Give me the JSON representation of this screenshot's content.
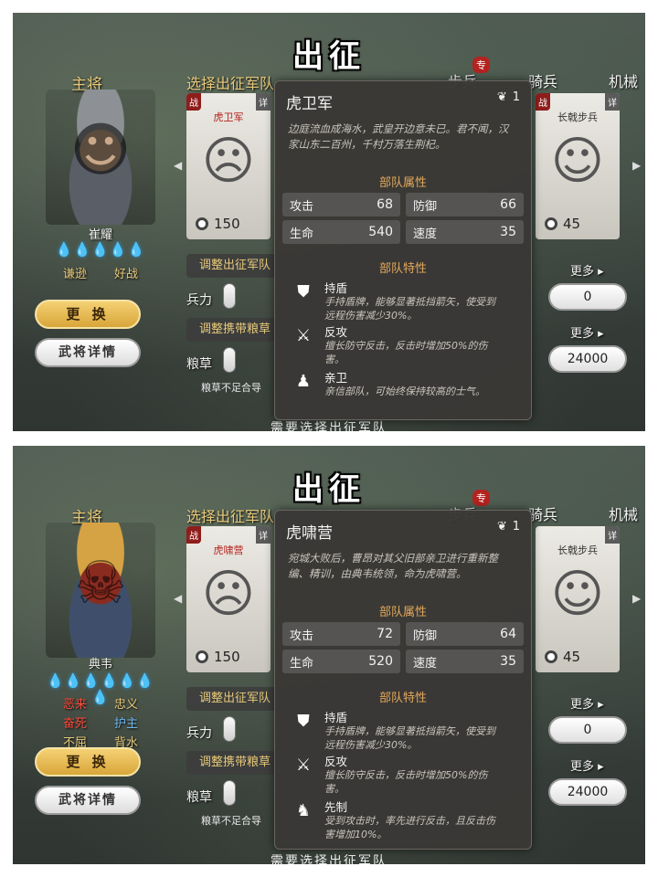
{
  "screens": [
    {
      "title": "出征",
      "commander_label": "主将",
      "general": {
        "name": "崔耀",
        "stars": "💧💧💧💧💧",
        "traits": [
          {
            "text": "谦逊",
            "color": "#e8c97a"
          },
          {
            "text": "好战",
            "color": "#e8c97a"
          }
        ]
      },
      "buttons": {
        "replace": "更 换",
        "details": "武将详情"
      },
      "select_label": "选择出征军队",
      "tabs": [
        "步兵",
        "骑兵",
        "机械"
      ],
      "tab_badge": "专",
      "left_card": {
        "war": "战",
        "detail": "详",
        "name": "虎卫军",
        "cost": "150"
      },
      "right_card": {
        "war": "战",
        "detail": "详",
        "name": "长戟步兵",
        "cost": "45"
      },
      "adjust_troops": "调整出征军队",
      "troops_label": "兵力",
      "adjust_supplies": "调整携带粮草",
      "supplies_label": "粮草",
      "warning": "粮草不足合导",
      "footer": "需要选择出征军队",
      "more": "更多",
      "troops_value": "0",
      "supplies_value": "24000",
      "tooltip": {
        "name": "虎卫军",
        "count": "1",
        "desc": "边庭流血成海水，武皇开边意未已。君不闻，汉家山东二百州，千村万落生荆杞。",
        "attr_title": "部队属性",
        "stats": [
          {
            "label": "攻击",
            "value": "68"
          },
          {
            "label": "防御",
            "value": "66"
          },
          {
            "label": "生命",
            "value": "540"
          },
          {
            "label": "速度",
            "value": "35"
          }
        ],
        "feature_title": "部队特性",
        "features": [
          {
            "icon": "shield-icon",
            "glyph": "⛊",
            "name": "持盾",
            "desc": "手持盾牌，能够显著抵挡箭矢，使受到远程伤害减少30%。"
          },
          {
            "icon": "counterattack-icon",
            "glyph": "⚔",
            "name": "反攻",
            "desc": "擅长防守反击，反击时增加50%的伤害。"
          },
          {
            "icon": "guard-icon",
            "glyph": "♟",
            "name": "亲卫",
            "desc": "亲信部队，可始终保持较高的士气。"
          }
        ]
      }
    },
    {
      "title": "出征",
      "commander_label": "主将",
      "general": {
        "name": "典韦",
        "stars": "💧💧💧💧💧💧💧",
        "traits": [
          {
            "text": "恶来",
            "color": "#ff4a3a"
          },
          {
            "text": "忠义",
            "color": "#e8c97a"
          },
          {
            "text": "奋死",
            "color": "#ff4a3a"
          },
          {
            "text": "护主",
            "color": "#6fb6f0"
          },
          {
            "text": "不屈",
            "color": "#e8c97a"
          },
          {
            "text": "背水",
            "color": "#e8c97a"
          }
        ]
      },
      "buttons": {
        "replace": "更 换",
        "details": "武将详情"
      },
      "select_label": "选择出征军队",
      "tabs": [
        "步兵",
        "骑兵",
        "机械"
      ],
      "tab_badge": "专",
      "left_card": {
        "war": "战",
        "detail": "详",
        "name": "虎啸营",
        "cost": "150"
      },
      "right_card": {
        "war": "",
        "detail": "详",
        "name": "长戟步兵",
        "cost": "45"
      },
      "adjust_troops": "调整出征军队",
      "troops_label": "兵力",
      "adjust_supplies": "调整携带粮草",
      "supplies_label": "粮草",
      "warning": "粮草不足合导",
      "footer": "需要选择出征军队",
      "more": "更多",
      "troops_value": "0",
      "supplies_value": "24000",
      "tooltip": {
        "name": "虎啸营",
        "count": "1",
        "desc": "宛城大败后，曹昂对其父旧部亲卫进行重新整编、精训，由典韦统领，命为虎啸营。",
        "attr_title": "部队属性",
        "stats": [
          {
            "label": "攻击",
            "value": "72"
          },
          {
            "label": "防御",
            "value": "64"
          },
          {
            "label": "生命",
            "value": "520"
          },
          {
            "label": "速度",
            "value": "35"
          }
        ],
        "feature_title": "部队特性",
        "features": [
          {
            "icon": "shield-icon",
            "glyph": "⛊",
            "name": "持盾",
            "desc": "手持盾牌，能够显著抵挡箭矢，使受到远程伤害减少30%。"
          },
          {
            "icon": "counterattack-icon",
            "glyph": "⚔",
            "name": "反攻",
            "desc": "擅长防守反击，反击时增加50%的伤害。"
          },
          {
            "icon": "preempt-icon",
            "glyph": "♞",
            "name": "先制",
            "desc": "受到攻击时，率先进行反击，且反击伤害增加10%。"
          }
        ]
      }
    }
  ]
}
